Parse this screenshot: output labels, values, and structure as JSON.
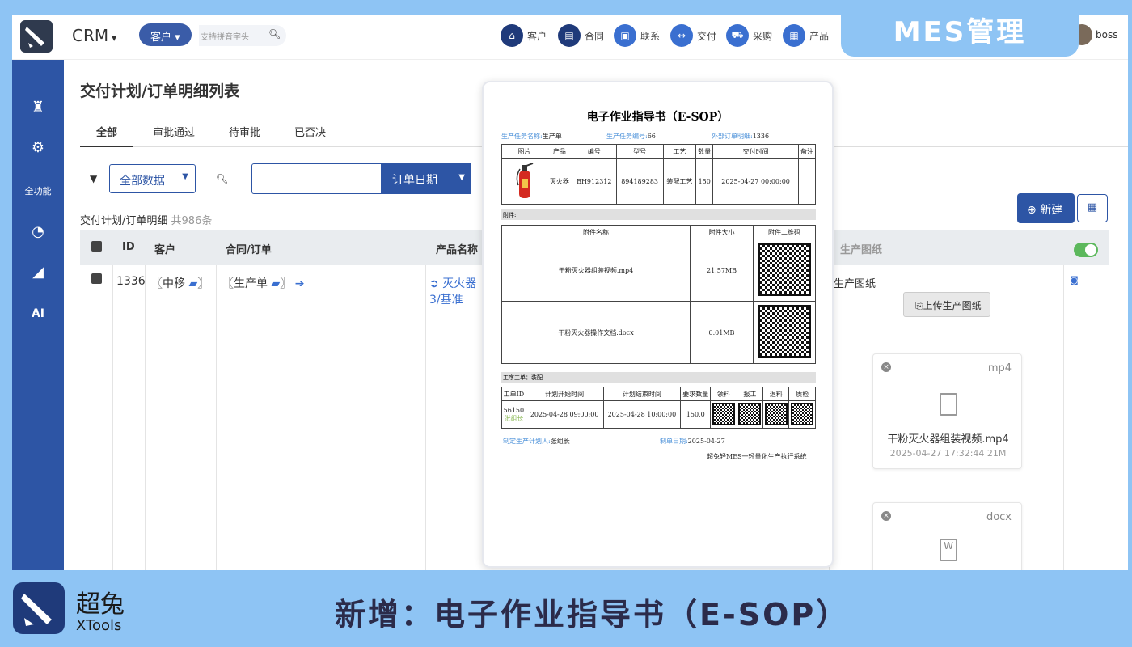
{
  "header": {
    "app_name": "CRM",
    "search_scope": "客户",
    "search_placeholder": "支持拼音字头",
    "nav": [
      {
        "label": "客户",
        "icon": "bank-icon",
        "color": "#1f3a7a"
      },
      {
        "label": "合同",
        "icon": "file-icon",
        "color": "#1f3a7a"
      },
      {
        "label": "联系",
        "icon": "contact-card-icon",
        "color": "#3a6fd0"
      },
      {
        "label": "交付",
        "icon": "arrows-h-icon",
        "color": "#3a6fd0"
      },
      {
        "label": "采购",
        "icon": "cart-icon",
        "color": "#3a6fd0"
      },
      {
        "label": "产品",
        "icon": "grid-icon",
        "color": "#3a6fd0"
      }
    ],
    "user": "boss"
  },
  "badge": "MES管理",
  "sidebar": {
    "items": [
      {
        "icon": "castle-icon",
        "label": ""
      },
      {
        "icon": "cogs-icon",
        "label": ""
      },
      {
        "icon": "",
        "label": "全功能"
      },
      {
        "icon": "dashboard-icon",
        "label": ""
      },
      {
        "icon": "area-chart-icon",
        "label": ""
      },
      {
        "icon": "",
        "label": "AI"
      }
    ]
  },
  "page": {
    "title": "交付计划/订单明细列表",
    "tabs": [
      "全部",
      "审批通过",
      "待审批",
      "已否决"
    ],
    "filter_select": "全部数据",
    "date_button": "订单日期",
    "count_label": "交付计划/订单明细",
    "count_value": "共986条",
    "new_button": "新建"
  },
  "table": {
    "headers": {
      "id": "ID",
      "customer": "客户",
      "contract": "合同/订单",
      "product": "产品名称",
      "drawing": "生产图纸"
    },
    "row": {
      "id": "1336",
      "customer": "〖中移",
      "customer_end": "〗",
      "contract": "〖生产单",
      "contract_end": "〗",
      "product": "灭火器",
      "product_line2": "3/基准",
      "drawing_label": "生产图纸",
      "upload_button": "上传生产图纸"
    },
    "files": [
      {
        "ext": "mp4",
        "name": "干粉灭火器组装视频.mp4",
        "meta": "2025-04-27 17:32:44 21M"
      },
      {
        "ext": "docx",
        "name": "",
        "meta": ""
      }
    ]
  },
  "sop": {
    "title": "电子作业指导书（E-SOP）",
    "task_name_label": "生产任务名称:",
    "task_name": "生产单",
    "task_no_label": "生产任务编号:",
    "task_no": "66",
    "ext_order_label": "外部订单明细:",
    "ext_order": "1336",
    "prod_headers": [
      "图片",
      "产品",
      "编号",
      "型号",
      "工艺",
      "数量",
      "交付时间",
      "备注"
    ],
    "prod_row": [
      "",
      "灭火器",
      "BH912312",
      "894189283",
      "装配工艺",
      "150",
      "2025-04-27 00:00:00",
      ""
    ],
    "attach_section": "附件:",
    "attach_headers": [
      "附件名称",
      "附件大小",
      "附件二维码"
    ],
    "attachments": [
      {
        "name": "干粉灭火器组装视频.mp4",
        "size": "21.57MB"
      },
      {
        "name": "干粉灭火器操作文档.docx",
        "size": "0.01MB"
      }
    ],
    "process_section": "工序工单：装配",
    "wo_headers": [
      "工单ID",
      "计划开始时间",
      "计划结束时间",
      "要求数量",
      "领料",
      "报工",
      "退料",
      "质检"
    ],
    "wo_row": {
      "id": "56150",
      "leader": "张组长",
      "start": "2025-04-28 09:00:00",
      "end": "2025-04-28 10:00:00",
      "qty": "150.0"
    },
    "planner_label": "制定生产计划人:",
    "planner": "张组长",
    "date_label": "制单日期:",
    "date": "2025-04-27",
    "footer": "超兔轻MES一轻量化生产执行系统"
  },
  "footer": {
    "brand_cn": "超兔",
    "brand_en": "XTools",
    "title": "新增：电子作业指导书（E-SOP）"
  }
}
